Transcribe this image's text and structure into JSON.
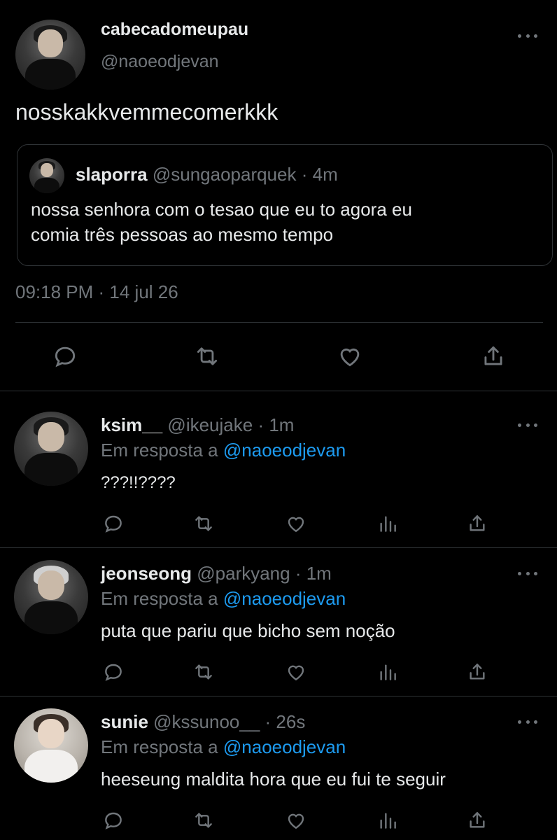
{
  "main_tweet": {
    "display_name": "cabecadomeupau",
    "handle": "@naoeodjevan",
    "text": "nosskakkvemmecomerkkk",
    "timestamp": "09:18 PM · 14 jul 26",
    "quoted": {
      "display_name": "slaporra",
      "handle": "@sungaoparquek",
      "time": "· 4m",
      "text_line1": "nossa senhora com o tesao que eu to agora eu",
      "text_line2": "comia três pessoas ao mesmo tempo"
    }
  },
  "replies": [
    {
      "display_name": "ksim__",
      "handle": "@ikeujake",
      "time": "· 1m",
      "reply_prefix": "Em resposta a",
      "reply_to": "@naoeodjevan",
      "text": "???!!????"
    },
    {
      "display_name": "jeonseong",
      "handle": "@parkyang",
      "time": "· 1m",
      "reply_prefix": "Em resposta a",
      "reply_to": "@naoeodjevan",
      "text": "puta que pariu que bicho sem noção"
    },
    {
      "display_name": "sunie",
      "handle": "@kssunoo__",
      "time": "· 26s",
      "reply_prefix": "Em resposta a",
      "reply_to": "@naoeodjevan",
      "text": "heeseung maldita hora que eu fui te seguir"
    }
  ],
  "icons": {
    "reply": "reply-icon",
    "retweet": "retweet-icon",
    "like": "like-icon",
    "analytics": "analytics-icon",
    "share": "share-icon",
    "more": "more-icon"
  },
  "colors": {
    "background": "#000000",
    "text": "#e7e9ea",
    "muted": "#71767b",
    "link": "#1d9bf0",
    "border": "#2f3336"
  }
}
